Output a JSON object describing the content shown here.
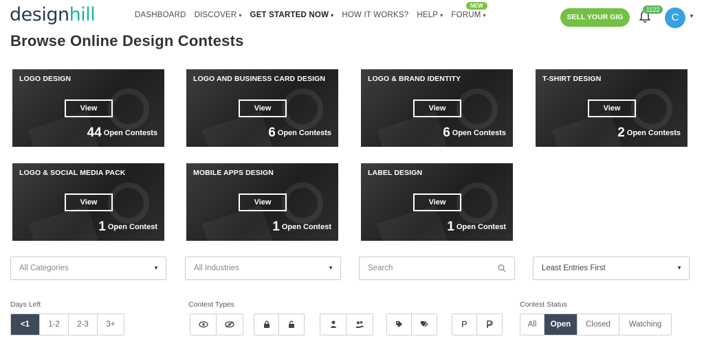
{
  "brand": {
    "logo_part1": "design",
    "logo_part2": "hill"
  },
  "nav": {
    "items": [
      {
        "label": "DASHBOARD",
        "caret": ""
      },
      {
        "label": "DISCOVER",
        "caret": "▾"
      },
      {
        "label": "GET STARTED NOW",
        "caret": "▾"
      },
      {
        "label": "HOW IT WORKS?",
        "caret": ""
      },
      {
        "label": "HELP",
        "caret": "▾"
      },
      {
        "label": "FORUM",
        "caret": "▾"
      }
    ],
    "new_badge": "NEW",
    "sell_button": "SELL YOUR GIG",
    "notification_count": "1122",
    "avatar_initial": "C"
  },
  "page_title": "Browse Online Design Contests",
  "categories": [
    {
      "title": "LOGO DESIGN",
      "view": "View",
      "count": "44",
      "count_label": "Open Contests"
    },
    {
      "title": "LOGO AND BUSINESS CARD DESIGN",
      "view": "View",
      "count": "6",
      "count_label": "Open Contests"
    },
    {
      "title": "LOGO & BRAND IDENTITY",
      "view": "View",
      "count": "6",
      "count_label": "Open Contests"
    },
    {
      "title": "T-SHIRT DESIGN",
      "view": "View",
      "count": "2",
      "count_label": "Open Contests"
    },
    {
      "title": "LOGO & SOCIAL MEDIA PACK",
      "view": "View",
      "count": "1",
      "count_label": "Open Contest"
    },
    {
      "title": "MOBILE APPS DESIGN",
      "view": "View",
      "count": "1",
      "count_label": "Open Contest"
    },
    {
      "title": "LABEL DESIGN",
      "view": "View",
      "count": "1",
      "count_label": "Open Contest"
    }
  ],
  "filters": {
    "categories_placeholder": "All Categories",
    "industries_placeholder": "All Industries",
    "search_placeholder": "Search",
    "sort_value": "Least Entries First"
  },
  "days_left": {
    "label": "Days Left",
    "options": [
      "<1",
      "1-2",
      "2-3",
      "3+"
    ]
  },
  "contest_types": {
    "label": "Contest Types",
    "p_label": "P"
  },
  "contest_status": {
    "label": "Contest Status",
    "options": [
      "All",
      "Open",
      "Closed",
      "Watching"
    ]
  },
  "colors": {
    "accent_green": "#74c044",
    "brand_teal": "#1ab3a6",
    "active_dark": "#3c4a5a",
    "avatar_blue": "#3aa0e0"
  }
}
